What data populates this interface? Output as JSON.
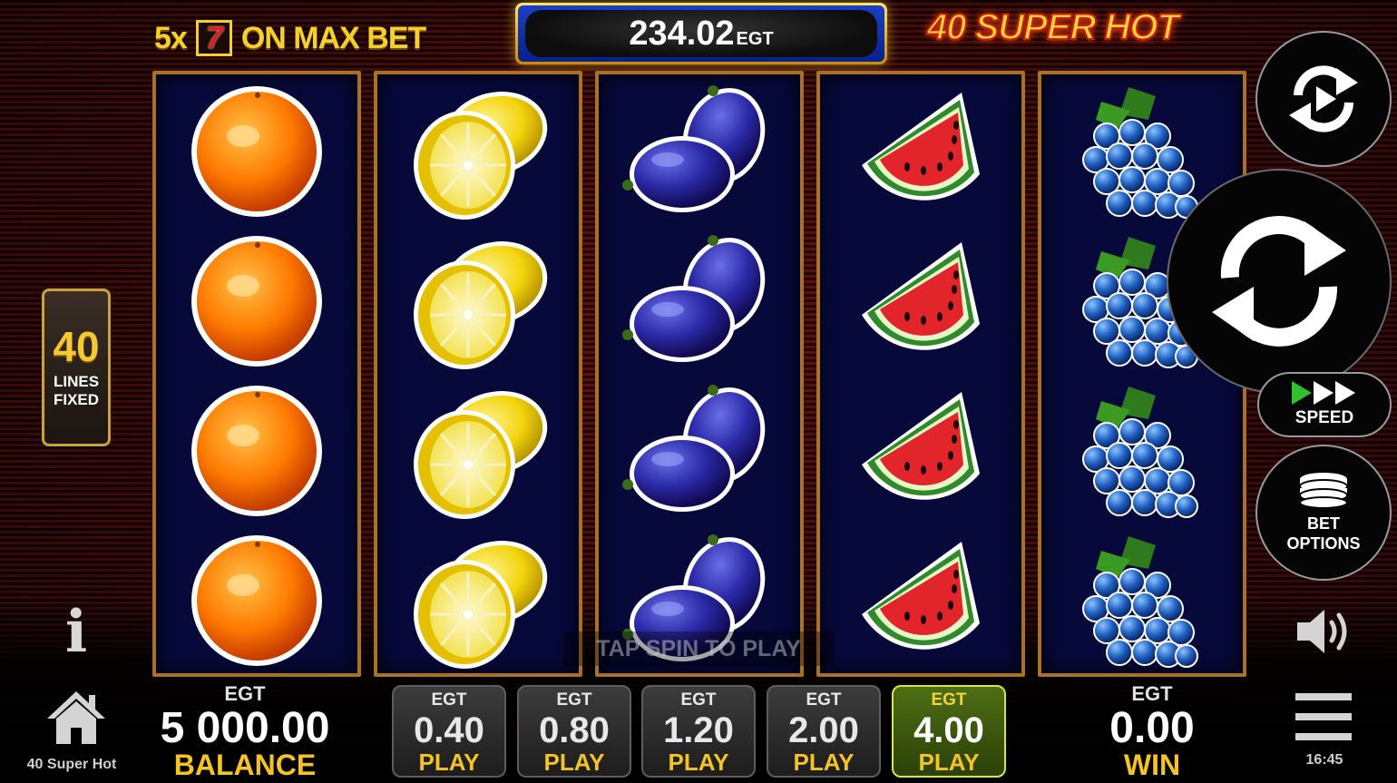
{
  "game": {
    "name": "40 Super Hot",
    "logo_text": "40 SUPER HOT",
    "clock": "16:45"
  },
  "promo": {
    "multiplier": "5x",
    "symbol": "7",
    "text": "ON MAX BET"
  },
  "jackpot": {
    "value": "234.02",
    "currency": "EGT"
  },
  "lines": {
    "count": "40",
    "label_line1": "LINES",
    "label_line2": "FIXED"
  },
  "reels": [
    {
      "symbol": "orange",
      "rows": [
        "orange",
        "orange",
        "orange",
        "orange"
      ]
    },
    {
      "symbol": "lemon",
      "rows": [
        "lemon",
        "lemon",
        "lemon",
        "lemon"
      ]
    },
    {
      "symbol": "plum",
      "rows": [
        "plum",
        "plum",
        "plum",
        "plum"
      ]
    },
    {
      "symbol": "watermelon",
      "rows": [
        "watermelon",
        "watermelon",
        "watermelon",
        "watermelon"
      ]
    },
    {
      "symbol": "grapes",
      "rows": [
        "grapes",
        "grapes",
        "grapes",
        "grapes"
      ]
    }
  ],
  "hint": "TAP SPIN TO PLAY",
  "controls": {
    "autoplay_icon": "autoplay-icon",
    "spin_icon": "spin-icon",
    "speed_label": "SPEED",
    "bet_options_line1": "BET",
    "bet_options_line2": "OPTIONS",
    "info_icon": "info-icon",
    "sound_icon": "sound-icon",
    "home_icon": "home-icon",
    "menu_icon": "menu-icon"
  },
  "balance": {
    "currency": "EGT",
    "value": "5 000.00",
    "label": "BALANCE"
  },
  "win": {
    "currency": "EGT",
    "value": "0.00",
    "label": "WIN"
  },
  "bets": [
    {
      "currency": "EGT",
      "value": "0.40",
      "label": "PLAY",
      "active": false
    },
    {
      "currency": "EGT",
      "value": "0.80",
      "label": "PLAY",
      "active": false
    },
    {
      "currency": "EGT",
      "value": "1.20",
      "label": "PLAY",
      "active": false
    },
    {
      "currency": "EGT",
      "value": "2.00",
      "label": "PLAY",
      "active": false
    },
    {
      "currency": "EGT",
      "value": "4.00",
      "label": "PLAY",
      "active": true
    }
  ],
  "colors": {
    "gold": "#f5c322",
    "active_bet": "#4d6e14",
    "reel_bg": "#06093a",
    "reel_border": "#a8702a"
  }
}
